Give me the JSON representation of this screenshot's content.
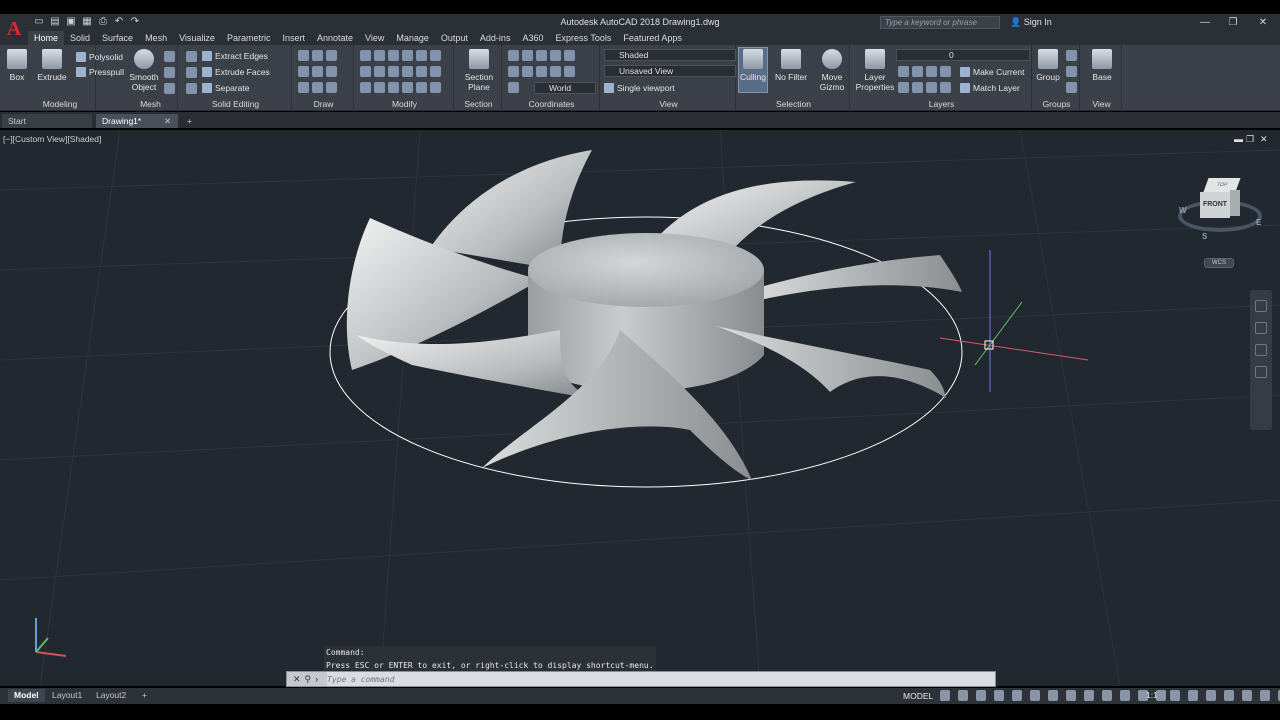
{
  "app": {
    "logo": "A",
    "title": "Autodesk AutoCAD 2018   Drawing1.dwg",
    "search_placeholder": "Type a keyword or phrase",
    "signin": "Sign In"
  },
  "quick_access": [
    "new-icon",
    "open-icon",
    "save-icon",
    "saveas-icon",
    "plot-icon",
    "undo-icon",
    "redo-icon"
  ],
  "tabs": [
    "Home",
    "Solid",
    "Surface",
    "Mesh",
    "Visualize",
    "Parametric",
    "Insert",
    "Annotate",
    "View",
    "Manage",
    "Output",
    "Add-ins",
    "A360",
    "Express Tools",
    "Featured Apps"
  ],
  "ribbon": {
    "modeling": {
      "box": "Box",
      "extrude": "Extrude",
      "polysolid": "Polysolid",
      "presspull": "Presspull",
      "label": "Modeling"
    },
    "mesh": {
      "smooth_object": "Smooth Object",
      "label": "Mesh"
    },
    "solid_editing": {
      "extract_edges": "Extract Edges",
      "extrude_faces": "Extrude Faces",
      "separate": "Separate",
      "label": "Solid Editing"
    },
    "draw": {
      "label": "Draw"
    },
    "modify": {
      "label": "Modify"
    },
    "section": {
      "section_plane": "Section Plane",
      "label": "Section"
    },
    "coordinates": {
      "world": "World",
      "label": "Coordinates"
    },
    "view": {
      "visual_style": "Shaded",
      "named_view": "Unsaved View",
      "viewport": "Single viewport",
      "label": "View"
    },
    "selection": {
      "culling": "Culling",
      "no_filter": "No Filter",
      "move_gizmo": "Move Gizmo",
      "label": "Selection"
    },
    "layers": {
      "layer_properties": "Layer Properties",
      "current_layer": "0",
      "make_current": "Make Current",
      "match_layer": "Match Layer",
      "label": "Layers"
    },
    "groups": {
      "group": "Group",
      "label": "Groups"
    },
    "view2": {
      "base": "Base",
      "label": "View"
    }
  },
  "file_tabs": {
    "start": "Start",
    "drawing": "Drawing1*"
  },
  "viewport": {
    "label": "[−][Custom View][Shaded]",
    "viewcube_face": "FRONT",
    "viewcube_top": "TOP",
    "compass": {
      "n": "W",
      "s": "S",
      "e": "E"
    },
    "wcs": "WCS"
  },
  "command": {
    "history": [
      "Command:",
      "Press ESC or ENTER to exit, or right-click to display shortcut-menu."
    ],
    "placeholder": "Type a command"
  },
  "layout_tabs": [
    "Model",
    "Layout1",
    "Layout2"
  ],
  "status": {
    "model": "MODEL",
    "scale": "1:1"
  }
}
